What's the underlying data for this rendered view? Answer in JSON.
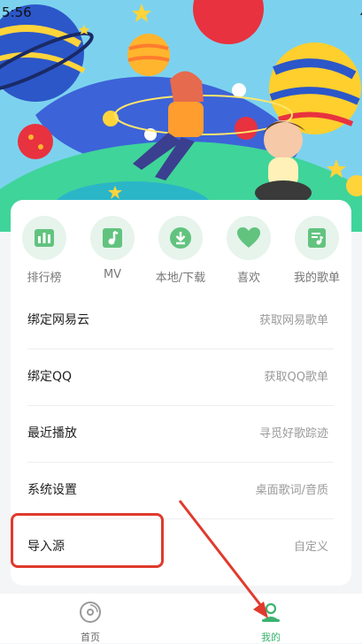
{
  "status": {
    "time": "5:56"
  },
  "quick_actions": [
    {
      "label": "排行榜",
      "icon": "bar-chart-icon"
    },
    {
      "label": "MV",
      "icon": "music-note-icon"
    },
    {
      "label": "本地/下载",
      "icon": "download-icon"
    },
    {
      "label": "喜欢",
      "icon": "heart-icon"
    },
    {
      "label": "我的歌单",
      "icon": "playlist-icon"
    }
  ],
  "menu": [
    {
      "title": "绑定网易云",
      "hint": "获取网易歌单"
    },
    {
      "title": "绑定QQ",
      "hint": "获取QQ歌单"
    },
    {
      "title": "最近播放",
      "hint": "寻觅好歌踪迹"
    },
    {
      "title": "系统设置",
      "hint": "桌面歌词/音质"
    },
    {
      "title": "导入源",
      "hint": "自定义"
    }
  ],
  "tabs": [
    {
      "label": "首页",
      "icon": "disc-icon",
      "active": false
    },
    {
      "label": "我的",
      "icon": "user-icon",
      "active": true
    }
  ],
  "colors": {
    "accent": "#3cb371",
    "highlight": "#e03a2e",
    "icon_bg": "#e6f4ec",
    "icon_fg": "#62c37f"
  }
}
